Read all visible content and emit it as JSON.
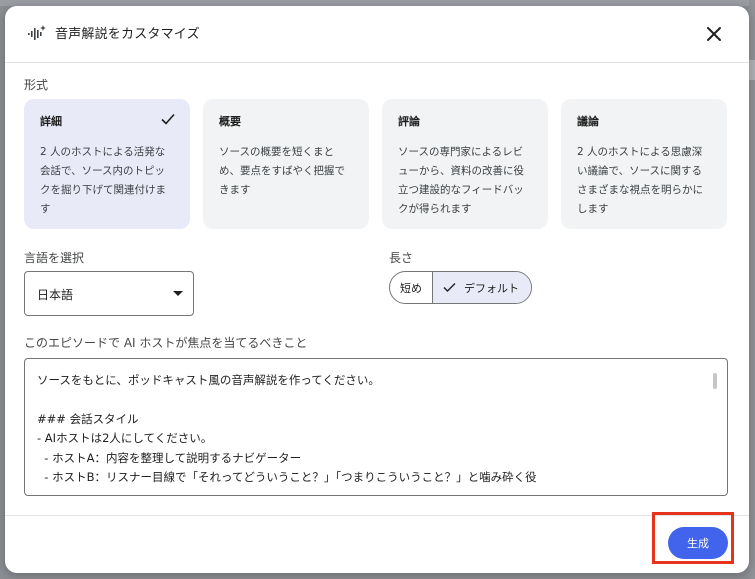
{
  "dialog": {
    "title": "音声解説をカスタマイズ",
    "close_icon": "close-icon",
    "title_icon": "audio-sparkle-icon"
  },
  "format": {
    "label": "形式",
    "cards": [
      {
        "title": "詳細",
        "desc_lines": [
          "2 人のホストによる活発な",
          "会話で、ソース内のトピッ",
          "クを掘り下げて関連付けま",
          "す"
        ],
        "selected": true
      },
      {
        "title": "概要",
        "desc_lines": [
          "ソースの概要を短くまと",
          "め、要点をすばやく把握で",
          "きます"
        ],
        "selected": false
      },
      {
        "title": "評論",
        "desc_lines": [
          "ソースの専門家によるレビ",
          "ューから、資料の改善に役",
          "立つ建設的なフィードバッ",
          "クが得られます"
        ],
        "selected": false
      },
      {
        "title": "議論",
        "desc_lines": [
          "2 人のホストによる思慮深",
          "い議論で、ソースに関する",
          "さまざまな視点を明らかに",
          "します"
        ],
        "selected": false
      }
    ]
  },
  "language": {
    "label": "言語を選択",
    "selected": "日本語"
  },
  "length": {
    "label": "長さ",
    "options": [
      "短め",
      "デフォルト"
    ],
    "selected": "デフォルト"
  },
  "focus": {
    "label": "このエピソードで AI ホストが焦点を当てるべきこと",
    "value": "ソースをもとに、ポッドキャスト風の音声解説を作ってください。\n\n### 会話スタイル\n- AIホストは2人にしてください。\n  - ホストA：内容を整理して説明するナビゲーター\n  - ホストB：リスナー目線で「それってどういうこと？」「つまりこういうこと？」と噛み砕く役"
  },
  "actions": {
    "generate_label": "生成"
  },
  "colors": {
    "accent": "#4263eb",
    "selected_card": "#e8eaf7",
    "card": "#f1f3f4",
    "highlight": "#e5341b"
  }
}
